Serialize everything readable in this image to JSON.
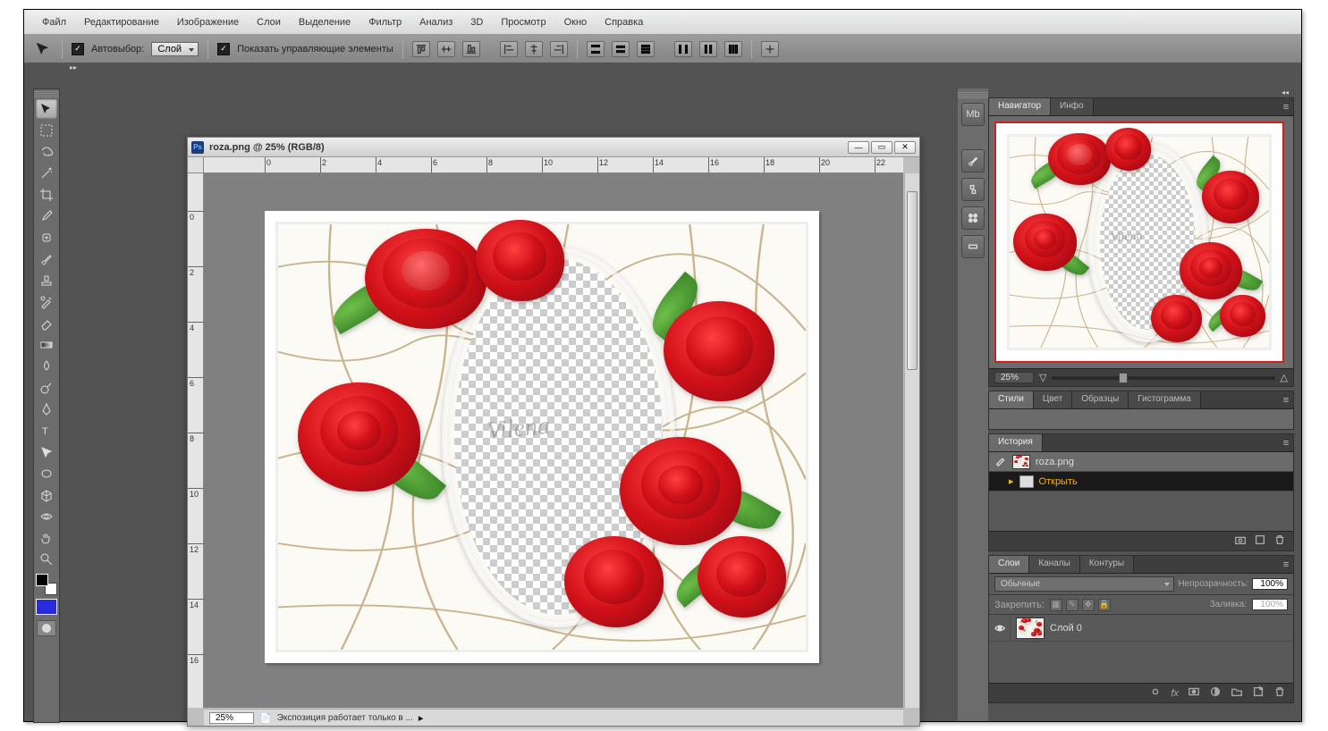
{
  "menu": [
    "Файл",
    "Редактирование",
    "Изображение",
    "Слои",
    "Выделение",
    "Фильтр",
    "Анализ",
    "3D",
    "Просмотр",
    "Окно",
    "Справка"
  ],
  "options": {
    "autoSelectLabel": "Автовыбор:",
    "autoSelectValue": "Слой",
    "showTransformLabel": "Показать управляющие элементы"
  },
  "document": {
    "title": "roza.png @ 25% (RGB/8)",
    "statusZoom": "25%",
    "statusText": "Экспозиция работает только в ...",
    "watermark": "Vilena",
    "rulerH": [
      0,
      2,
      4,
      6,
      8,
      10,
      12,
      14,
      16,
      18,
      20,
      22
    ],
    "rulerV": [
      0,
      2,
      4,
      6,
      8,
      10,
      12,
      14,
      16
    ]
  },
  "navigator": {
    "tabs": [
      "Навигатор",
      "Инфо"
    ],
    "zoom": "25%"
  },
  "stylesPanel": {
    "tabs": [
      "Стили",
      "Цвет",
      "Образцы",
      "Гистограмма"
    ]
  },
  "history": {
    "tab": "История",
    "source": "roza.png",
    "step": "Открыть"
  },
  "layers": {
    "tabs": [
      "Слои",
      "Каналы",
      "Контуры"
    ],
    "blendMode": "Обычные",
    "opacityLabel": "Непрозрачность:",
    "opacityValue": "100%",
    "lockLabel": "Закрепить:",
    "fillLabel": "Заливка:",
    "fillValue": "100%",
    "layerName": "Слой 0"
  },
  "colors": {
    "foreground": "#000000",
    "background": "#ffffff",
    "swatch": "#2a2ae0"
  }
}
